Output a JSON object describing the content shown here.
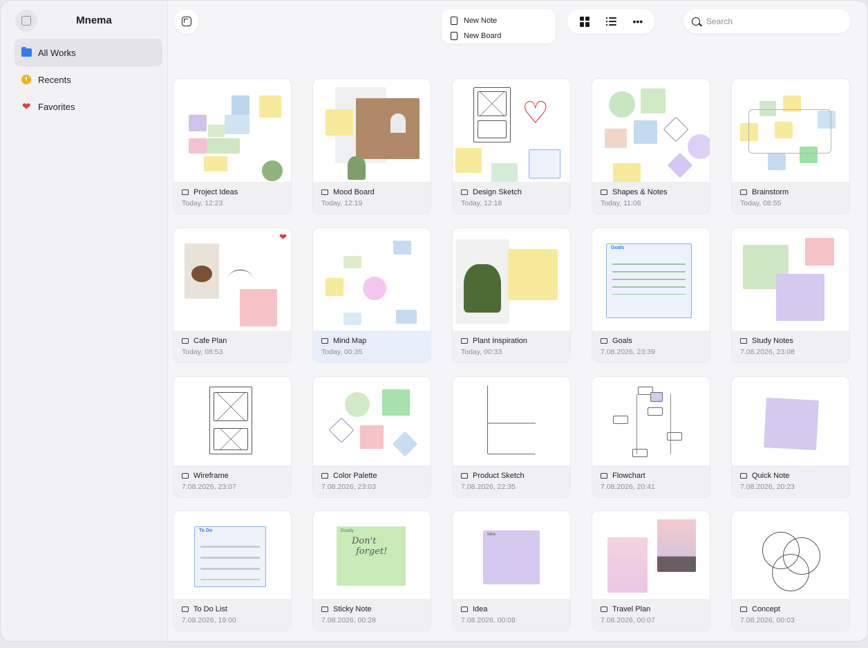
{
  "app": {
    "title": "Mnema"
  },
  "sidebar": {
    "items": [
      {
        "label": "All Works",
        "icon": "folder-icon"
      },
      {
        "label": "Recents",
        "icon": "clock-icon"
      },
      {
        "label": "Favorites",
        "icon": "heart-icon"
      }
    ]
  },
  "toolbar": {
    "new_menu": [
      {
        "label": "New Note"
      },
      {
        "label": "New Board"
      }
    ],
    "view_modes": [
      "grid-view",
      "list-view",
      "more"
    ],
    "more_label": "•••",
    "search_placeholder": "Search"
  },
  "cards": [
    {
      "title": "Project Ideas",
      "date": "Today, 12:23"
    },
    {
      "title": "Mood Board",
      "date": "Today, 12:19"
    },
    {
      "title": "Design Sketch",
      "date": "Today, 12:18"
    },
    {
      "title": "Shapes & Notes",
      "date": "Today, 11:08"
    },
    {
      "title": "Brainstorm",
      "date": "Today, 08:55"
    },
    {
      "title": "Cafe Plan",
      "date": "Today, 08:53",
      "favorite": true
    },
    {
      "title": "Mind Map",
      "date": "Today, 00:35",
      "selected": true
    },
    {
      "title": "Plant Inspiration",
      "date": "Today, 00:33"
    },
    {
      "title": "Goals",
      "date": "7.08.2026, 23:39"
    },
    {
      "title": "Study Notes",
      "date": "7.08.2026, 23:08"
    },
    {
      "title": "Wireframe",
      "date": "7.08.2026, 23:07"
    },
    {
      "title": "Color Palette",
      "date": "7.08.2026, 23:03"
    },
    {
      "title": "Product Sketch",
      "date": "7.08.2026, 22:35"
    },
    {
      "title": "Flowchart",
      "date": "7.08.2026, 20:41"
    },
    {
      "title": "Quick Note",
      "date": "7.08.2026, 20:23"
    },
    {
      "title": "To Do List",
      "date": "7.08.2026, 19:00"
    },
    {
      "title": "Sticky Note",
      "date": "7.08.2026, 00:28"
    },
    {
      "title": "Idea",
      "date": "7.08.2026, 00:08"
    },
    {
      "title": "Travel Plan",
      "date": "7.08.2026, 00:07"
    },
    {
      "title": "Concept",
      "date": "7.08.2026, 00:03"
    }
  ],
  "thumb_text": {
    "goals": "Goals",
    "todo": "To Do",
    "sticky_heading": "Doodly",
    "sticky_line1": "Don't",
    "sticky_line2": "forget!",
    "idea_label": "Idea"
  },
  "colors": {
    "accent": "#2f7cf6",
    "favorite": "#e33b35",
    "recents": "#f5b21b"
  }
}
